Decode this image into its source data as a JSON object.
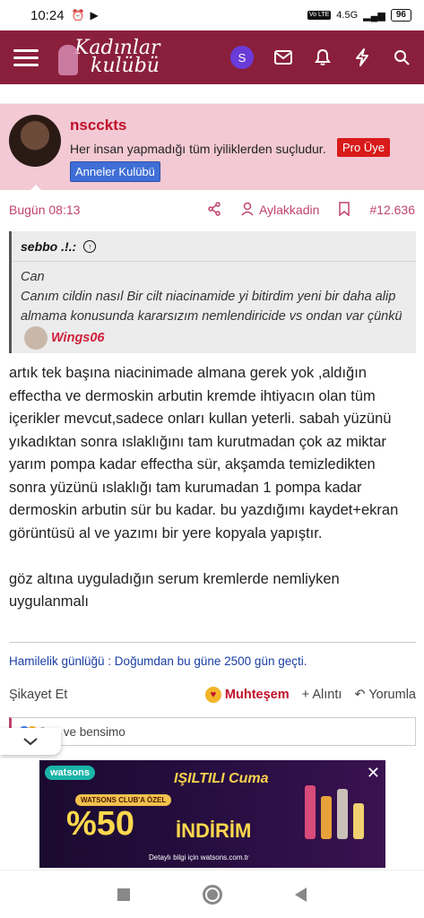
{
  "status": {
    "time": "10:24",
    "signal_text": "4.5G",
    "lte": "Vo LTE",
    "battery": "96"
  },
  "header": {
    "logo_line1": "Kadınlar",
    "logo_line2": "kulübü",
    "avatar_letter": "S"
  },
  "author": {
    "name": "nscckts",
    "title": "Her insan yapmadığı tüm iyiliklerden suçludur.",
    "pro_badge": "Pro Üye",
    "group_badge": "Anneler Kulübü"
  },
  "meta": {
    "date": "Bugün 08:13",
    "user": "Aylakkadin",
    "post_number": "#12.636"
  },
  "quote": {
    "author": "sebbo .!.:",
    "line1": "Can",
    "text": "Canım cildin nasıl Bir cilt niacinamide yi bitirdim yeni bir daha alip almama konusunda kararsızım nemlendiricide vs ondan var çünkü",
    "mention": "Wings06"
  },
  "post": {
    "para1": "artık tek başına niacinimade almana gerek yok ,aldığın effectha ve dermoskin arbutin kremde ihtiyacın olan tüm içerikler mevcut,sadece onları kullan yeterli. sabah yüzünü yıkadıktan sonra ıslaklığını tam kurutmadan çok az miktar yarım pompa kadar effectha sür, akşamda temizledikten sonra yüzünü ıslaklığı tam kurumadan 1 pompa kadar dermoskin arbutin sür bu kadar. bu yazdığımı kaydet+ekran görüntüsü al ve yazımı bir yere kopyala yapıştır.",
    "para2": "göz altına uyguladığın serum kremlerde nemliyken uygulanmalı"
  },
  "signature": "Hamilelik günlüğü : Doğumdan bu güne 2500 gün geçti.",
  "actions": {
    "report": "Şikayet Et",
    "reaction": "Muhteşem",
    "quote": "Alıntı",
    "reply": "Yorumla"
  },
  "reactions_text": "Sen ve bensimo",
  "ad": {
    "brand": "watsons",
    "headline": "IŞILTILI Cuma",
    "club": "WATSONS CLUB'A ÖZEL",
    "discount": "%50",
    "discount_word": "İNDİRİM",
    "details": "Detaylı bilgi için watsons.com.tr",
    "close": "✕"
  },
  "colors": {
    "brand": "#8a1f3c",
    "accent_pink": "#c0446a",
    "user_bg": "#f2c9d4",
    "link_blue": "#1a3fa3"
  }
}
